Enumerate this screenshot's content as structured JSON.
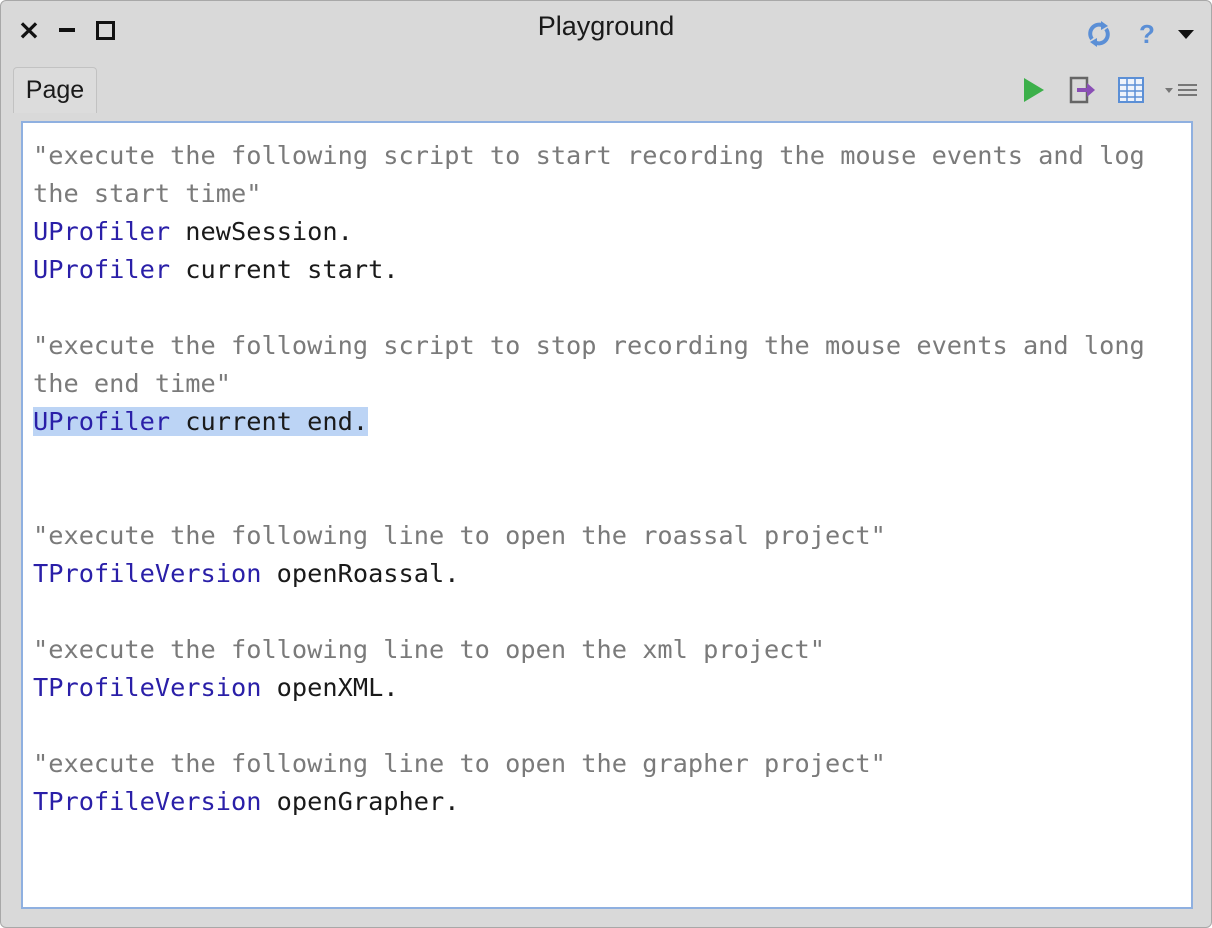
{
  "window": {
    "title": "Playground",
    "close_glyph": "×",
    "controls": [
      "close-icon",
      "minimize-icon",
      "maximize-icon"
    ],
    "right_controls": [
      "refresh-icon",
      "help-icon",
      "menu-arrow-icon"
    ],
    "help_glyph": "?"
  },
  "tabs": [
    {
      "label": "Page",
      "selected": true
    }
  ],
  "toolbar": {
    "icons": [
      "run-icon",
      "inspect-icon",
      "bindings-icon",
      "page-menu-icon"
    ],
    "colors": {
      "run": "#3cb04a",
      "inspect": "#8a4fb5",
      "bindings": "#5b8fd6"
    }
  },
  "editor": {
    "colors": {
      "comment": "#7a7a7a",
      "class": "#2a1fa8",
      "selection": "#bcd4f5",
      "border": "#8fb0e0"
    },
    "lines": [
      {
        "comment": "\"execute the following script to start recording the mouse events and log"
      },
      {
        "comment": "the start time\""
      },
      {
        "class": "UProfiler",
        "rest": " newSession."
      },
      {
        "class": "UProfiler",
        "rest": " current start."
      },
      {},
      {
        "comment": "\"execute the following script to stop recording the mouse events and long"
      },
      {
        "comment": "the end time\""
      },
      {
        "class": "UProfiler",
        "rest": " current end.",
        "selected": true
      },
      {},
      {},
      {
        "comment": "\"execute the following line to open the roassal project\""
      },
      {
        "class": "TProfileVersion",
        "rest": " openRoassal."
      },
      {},
      {
        "comment": "\"execute the following line to open the xml project\""
      },
      {
        "class": "TProfileVersion",
        "rest": " openXML."
      },
      {},
      {
        "comment": "\"execute the following line to open the grapher project\""
      },
      {
        "class": "TProfileVersion",
        "rest": " openGrapher."
      }
    ]
  }
}
